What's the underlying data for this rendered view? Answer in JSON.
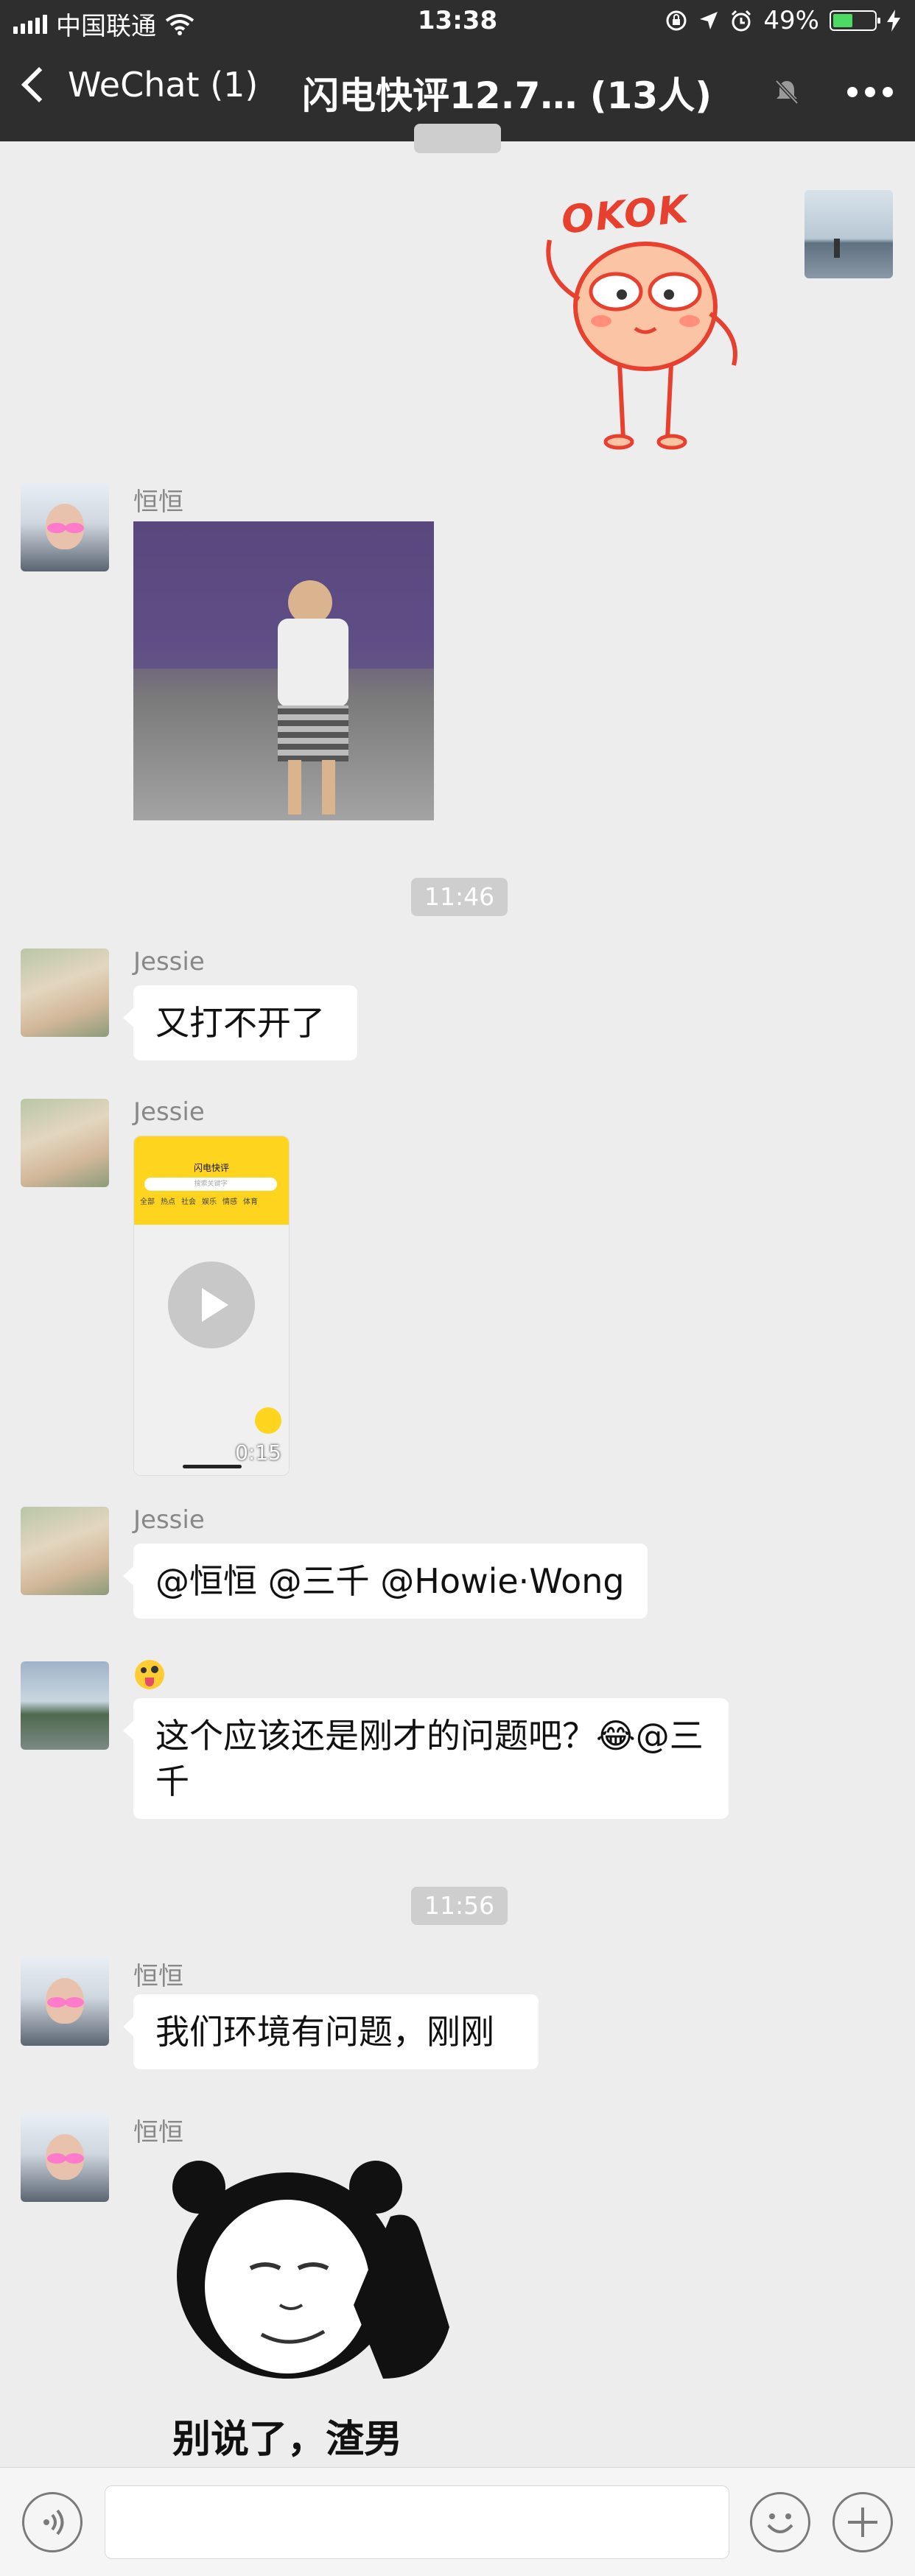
{
  "status_bar": {
    "carrier": "中国联通",
    "time": "13:38",
    "battery": "49%",
    "battery_level": 0.49
  },
  "nav": {
    "back_label": "WeChat (1)",
    "title": "闪电快评12.7… (13人)"
  },
  "messages": {
    "ts1": "11:46",
    "ts2": "11:56",
    "sticker_okok_text": "OKOK",
    "hengheng_name": "恒恒",
    "jessie_name": "Jessie",
    "jessie_msg1": "又打不开了",
    "video2_duration": "0:15",
    "video2_app_title": "闪电快评",
    "video2_search_placeholder": "搜索关键字",
    "video2_tabs": [
      "全部",
      "热点",
      "社会",
      "娱乐",
      "情感",
      "体育"
    ],
    "jessie_msg2": "@恒恒 @三千 @Howie·Wong",
    "palm_msg": "这个应该还是刚才的问题吧？😂@三千",
    "hengheng_msg": "我们环境有问题，刚刚",
    "panda_caption": "别说了，渣男"
  },
  "colors": {
    "nav_bg": "#2e2e2e",
    "chat_bg": "#ededed",
    "battery_green": "#4cd964",
    "timestamp_bg": "#cecece"
  },
  "icons": [
    "signal-icon",
    "wifi-icon",
    "lock-rotation-icon",
    "location-icon",
    "alarm-icon",
    "battery-icon",
    "charging-icon",
    "mute-icon",
    "more-icon",
    "voice-icon",
    "emoji-icon",
    "plus-icon",
    "play-icon"
  ]
}
